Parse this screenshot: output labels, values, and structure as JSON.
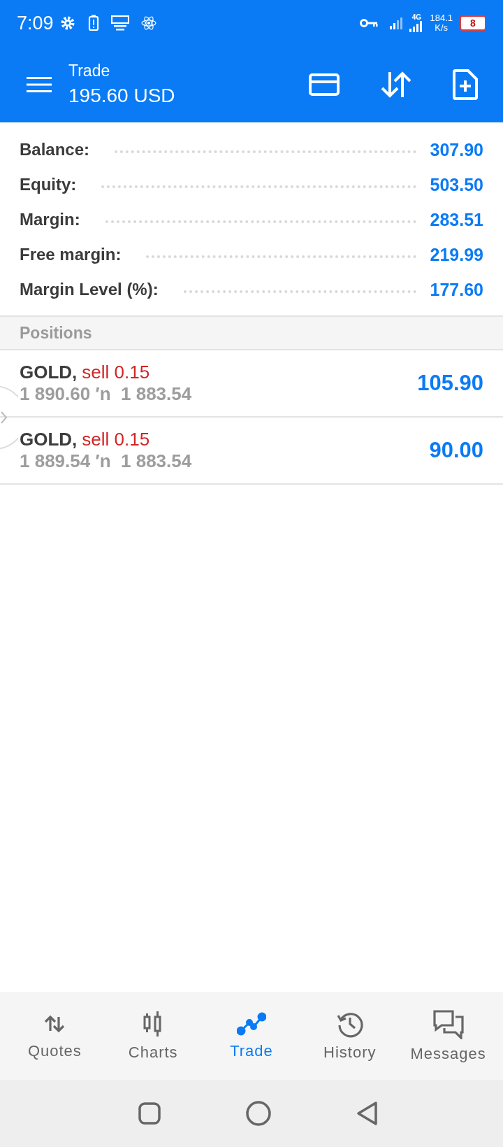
{
  "status_bar": {
    "time": "7:09",
    "network": "4G",
    "speed": "184.1",
    "speed_unit": "K/s",
    "battery": "8"
  },
  "header": {
    "title": "Trade",
    "subtitle": "195.60 USD"
  },
  "summary": [
    {
      "label": "Balance:",
      "value": "307.90"
    },
    {
      "label": "Equity:",
      "value": "503.50"
    },
    {
      "label": "Margin:",
      "value": "283.51"
    },
    {
      "label": "Free margin:",
      "value": "219.99"
    },
    {
      "label": "Margin Level (%):",
      "value": "177.60"
    }
  ],
  "positions": {
    "title": "Positions",
    "rows": [
      {
        "symbol": "GOLD,",
        "side": "sell 0.15",
        "prices": "1 890.60 ′n  1 883.54",
        "profit": "105.90"
      },
      {
        "symbol": "GOLD,",
        "side": "sell 0.15",
        "prices": "1 889.54 ′n  1 883.54",
        "profit": "90.00"
      }
    ]
  },
  "nav": [
    {
      "label": "Quotes",
      "kind": "quotes",
      "selected": false
    },
    {
      "label": "Charts",
      "kind": "charts",
      "selected": false
    },
    {
      "label": "Trade",
      "kind": "trade",
      "selected": true
    },
    {
      "label": "History",
      "kind": "history",
      "selected": false
    },
    {
      "label": "Messages",
      "kind": "messages",
      "selected": false
    }
  ]
}
